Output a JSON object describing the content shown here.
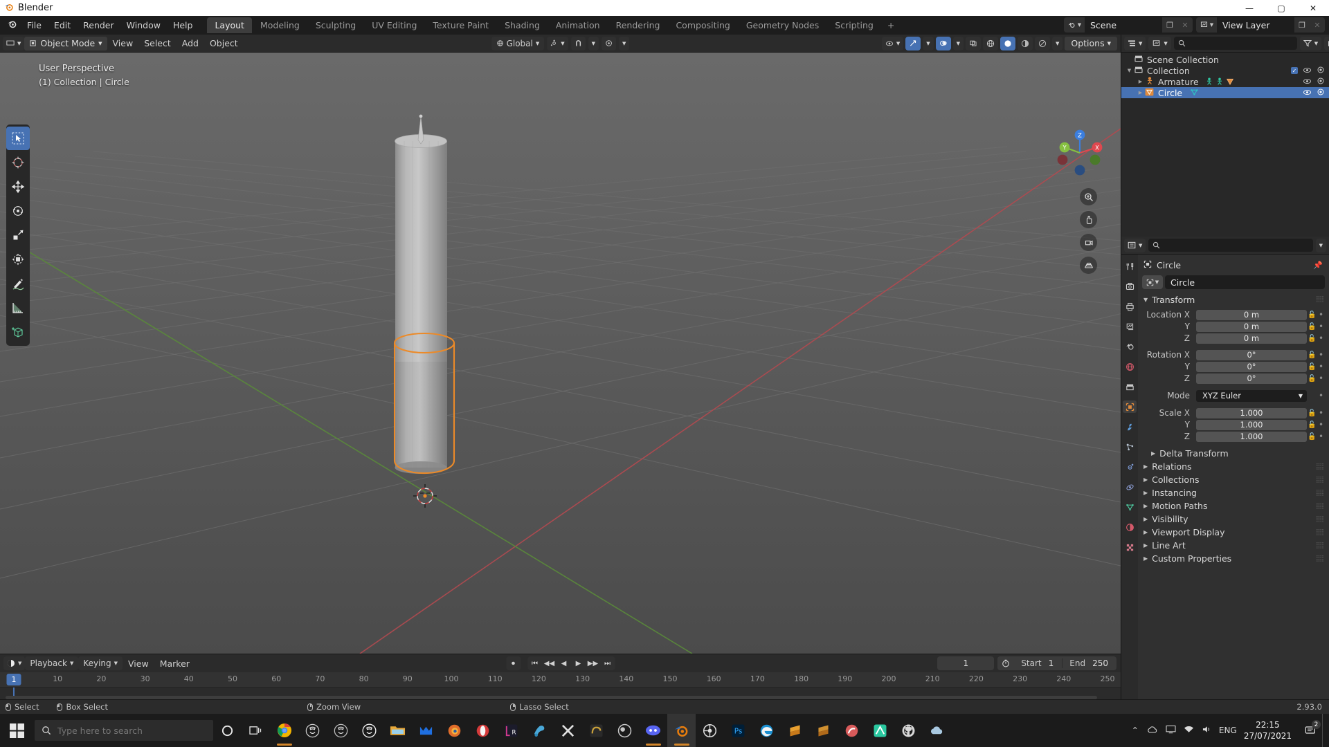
{
  "window": {
    "app_title": "Blender",
    "app_icon": "blender-logo-icon",
    "minimize": "—",
    "maximize": "▢",
    "close": "✕"
  },
  "topbar": {
    "menus": [
      "File",
      "Edit",
      "Render",
      "Window",
      "Help"
    ],
    "workspaces": [
      {
        "label": "Layout",
        "active": true
      },
      {
        "label": "Modeling",
        "active": false
      },
      {
        "label": "Sculpting",
        "active": false
      },
      {
        "label": "UV Editing",
        "active": false
      },
      {
        "label": "Texture Paint",
        "active": false
      },
      {
        "label": "Shading",
        "active": false
      },
      {
        "label": "Animation",
        "active": false
      },
      {
        "label": "Rendering",
        "active": false
      },
      {
        "label": "Compositing",
        "active": false
      },
      {
        "label": "Geometry Nodes",
        "active": false
      },
      {
        "label": "Scripting",
        "active": false
      },
      {
        "label": "+",
        "active": false
      }
    ],
    "scene_name": "Scene",
    "view_layer_name": "View Layer",
    "new_scene_icon": "duplicate-icon",
    "remove_scene_icon": "x-icon"
  },
  "viewport_header": {
    "mode": "Object Mode",
    "menus": [
      "View",
      "Select",
      "Add",
      "Object"
    ],
    "transform_orientation": "Global",
    "options_label": "Options",
    "snap_icon": "magnet-icon",
    "proportional_icon": "proportional-edit-icon",
    "visibility_icon": "eye-icon",
    "gizmo_icon": "gizmo-icon",
    "overlays_icon": "overlays-icon",
    "xray_icon": "xray-icon",
    "shading_modes": [
      "wireframe",
      "solid",
      "material-preview",
      "rendered"
    ],
    "shading_active": "solid"
  },
  "viewport": {
    "perspective_label": "User Perspective",
    "context_label": "(1) Collection | Circle",
    "tools": [
      {
        "name": "tweak-tool",
        "active": true
      },
      {
        "name": "cursor-tool",
        "active": false
      },
      {
        "name": "move-tool",
        "active": false
      },
      {
        "name": "rotate-tool",
        "active": false
      },
      {
        "name": "scale-tool",
        "active": false
      },
      {
        "name": "transform-tool",
        "active": false
      },
      {
        "name": "annotate-tool",
        "active": false
      },
      {
        "name": "measure-tool",
        "active": false
      },
      {
        "name": "add-cube-tool",
        "active": false
      }
    ],
    "gizmo_axes": [
      {
        "label": "X",
        "color": "#e0484f"
      },
      {
        "label": "Y",
        "color": "#86c041"
      },
      {
        "label": "Z",
        "color": "#3b7ede"
      }
    ],
    "nav_buttons": [
      "zoom-icon",
      "pan-icon",
      "camera-icon",
      "ortho-persp-icon"
    ]
  },
  "outliner": {
    "search_placeholder": "",
    "filter_icon": "filter-icon",
    "new_collection_icon": "new-collection-icon",
    "display_mode_icon": "view-layer-icon",
    "rows": [
      {
        "label": "Scene Collection",
        "icon": "collection-icon",
        "indent": 0,
        "selected": false,
        "has_disclosure": false,
        "checkbox": false,
        "eye": false,
        "camera": false
      },
      {
        "label": "Collection",
        "icon": "collection-icon",
        "indent": 1,
        "selected": false,
        "has_disclosure": true,
        "checkbox": true,
        "eye": true,
        "camera": true
      },
      {
        "label": "Armature",
        "icon": "armature-icon",
        "indent": 2,
        "selected": false,
        "has_disclosure": true,
        "checkbox": false,
        "eye": true,
        "camera": true
      },
      {
        "label": "Circle",
        "icon": "mesh-data-icon",
        "indent": 2,
        "selected": true,
        "has_disclosure": true,
        "checkbox": false,
        "eye": true,
        "camera": true
      }
    ]
  },
  "properties": {
    "search_placeholder": "",
    "breadcrumb_object": "Circle",
    "object_name": "Circle",
    "pin_icon": "pin-icon",
    "tabs": [
      {
        "name": "tool-tab",
        "glyph": "⚒",
        "color": "#c9c9c9",
        "active": false
      },
      {
        "name": "render-tab",
        "glyph": "☰",
        "color": "#c9c9c9",
        "active": false
      },
      {
        "name": "output-tab",
        "glyph": "⎙",
        "color": "#c9c9c9",
        "active": false
      },
      {
        "name": "view-layer-tab",
        "glyph": "▣",
        "color": "#c9c9c9",
        "active": false
      },
      {
        "name": "scene-tab",
        "glyph": "◔",
        "color": "#c9c9c9",
        "active": false
      },
      {
        "name": "world-tab",
        "glyph": "●",
        "color": "#d4596a",
        "active": false
      },
      {
        "name": "collection-tab",
        "glyph": "▤",
        "color": "#c9c9c9",
        "active": false
      },
      {
        "name": "object-tab",
        "glyph": "▣",
        "color": "#e08a3c",
        "active": true
      },
      {
        "name": "modifiers-tab",
        "glyph": "ὒ7",
        "color": "#5e9bd8",
        "active": false
      },
      {
        "name": "particles-tab",
        "glyph": "⁂",
        "color": "#b6c2d0",
        "active": false
      },
      {
        "name": "physics-tab",
        "glyph": "◎",
        "color": "#7c9ad4",
        "active": false
      },
      {
        "name": "constraints-tab",
        "glyph": "⛓",
        "color": "#8899cc",
        "active": false
      },
      {
        "name": "object-data-tab",
        "glyph": "▽",
        "color": "#4ec9a0",
        "active": false
      },
      {
        "name": "material-tab",
        "glyph": "◕",
        "color": "#d4596a",
        "active": false
      },
      {
        "name": "texture-tab",
        "glyph": "▦",
        "color": "#d4798a",
        "active": false
      }
    ],
    "transform_panel": "Transform",
    "location": {
      "label_x": "Location X",
      "label_y": "Y",
      "label_z": "Z",
      "x": "0 m",
      "y": "0 m",
      "z": "0 m"
    },
    "rotation": {
      "label_x": "Rotation X",
      "label_y": "Y",
      "label_z": "Z",
      "x": "0°",
      "y": "0°",
      "z": "0°"
    },
    "mode": {
      "label": "Mode",
      "value": "XYZ Euler"
    },
    "scale": {
      "label_x": "Scale X",
      "label_y": "Y",
      "label_z": "Z",
      "x": "1.000",
      "y": "1.000",
      "z": "1.000"
    },
    "sections": [
      "Delta Transform",
      "Relations",
      "Collections",
      "Instancing",
      "Motion Paths",
      "Visibility",
      "Viewport Display",
      "Line Art",
      "Custom Properties"
    ]
  },
  "timeline": {
    "editor_icon": "timeline-icon",
    "menus": [
      "Playback",
      "Keying",
      "View",
      "Marker"
    ],
    "record_icon": "record-icon",
    "transport": [
      "jump-start",
      "prev-keyframe",
      "play-reverse",
      "play",
      "next-keyframe",
      "jump-end"
    ],
    "current_frame": "1",
    "auto_key_icon": "stopwatch-icon",
    "start_label": "Start",
    "start_value": "1",
    "end_label": "End",
    "end_value": "250",
    "ticks": [
      "1",
      "10",
      "20",
      "30",
      "40",
      "50",
      "60",
      "70",
      "80",
      "90",
      "100",
      "110",
      "120",
      "130",
      "140",
      "150",
      "160",
      "170",
      "180",
      "190",
      "200",
      "210",
      "220",
      "230",
      "240",
      "250"
    ]
  },
  "statusbar": {
    "items": [
      {
        "label": "Select",
        "mouse": "l"
      },
      {
        "label": "Box Select",
        "mouse": "l"
      },
      {
        "label": "Zoom View",
        "mouse": "m"
      },
      {
        "label": "Lasso Select",
        "mouse": "r"
      }
    ],
    "version": "2.93.0"
  },
  "taskbar": {
    "start_icon": "windows-start-icon",
    "search_placeholder": "Type here to search",
    "cortana_icon": "cortana-icon",
    "taskview_icon": "task-view-icon",
    "apps": [
      {
        "name": "chrome-icon",
        "color": "#e8e8e8",
        "running": true,
        "active": false
      },
      {
        "name": "unreal-engine-icon",
        "color": "#cfcfcf",
        "running": false,
        "active": false
      },
      {
        "name": "unreal-engine-icon",
        "color": "#cfcfcf",
        "running": false,
        "active": false
      },
      {
        "name": "unreal-engine-icon",
        "color": "#e8e8e8",
        "running": false,
        "active": false
      },
      {
        "name": "file-explorer-icon",
        "color": "#e8b54a",
        "running": false,
        "active": false
      },
      {
        "name": "malwarebytes-icon",
        "color": "#1f6fe0",
        "running": false,
        "active": false
      },
      {
        "name": "firefox-icon",
        "color": "#e06c2a",
        "running": false,
        "active": false
      },
      {
        "name": "opera-icon",
        "color": "#d43a3a",
        "running": false,
        "active": false
      },
      {
        "name": "rider-icon",
        "color": "#d43a8a",
        "running": false,
        "active": false
      },
      {
        "name": "paint-icon",
        "color": "#4aa8d8",
        "running": false,
        "active": false
      },
      {
        "name": "xsplit-icon",
        "color": "#d8d8d8",
        "running": false,
        "active": false
      },
      {
        "name": "substance-icon",
        "color": "#c8a03a",
        "running": false,
        "active": false
      },
      {
        "name": "obs-icon",
        "color": "#c8c8c8",
        "running": false,
        "active": false
      },
      {
        "name": "discord-icon",
        "color": "#5865f2",
        "running": true,
        "active": false
      },
      {
        "name": "blender-icon",
        "color": "#e87d0d",
        "running": true,
        "active": true
      },
      {
        "name": "wheel-icon",
        "color": "#e0e0e0",
        "running": false,
        "active": false
      },
      {
        "name": "photoshop-icon",
        "color": "#2aa8e0",
        "running": false,
        "active": false
      },
      {
        "name": "edge-icon",
        "color": "#3aa8d8",
        "running": false,
        "active": false
      },
      {
        "name": "sublime-icon",
        "color": "#e8a030",
        "running": false,
        "active": false
      },
      {
        "name": "sublime-icon",
        "color": "#d09030",
        "running": false,
        "active": false
      },
      {
        "name": "krita-icon",
        "color": "#d85a5a",
        "running": false,
        "active": false
      },
      {
        "name": "mixer-icon",
        "color": "#2ac8a0",
        "running": false,
        "active": false
      },
      {
        "name": "github-icon",
        "color": "#d8d8d8",
        "running": false,
        "active": false
      },
      {
        "name": "cloud-icon",
        "color": "#a8c8e0",
        "running": false,
        "active": false
      }
    ],
    "tray_icons": [
      "chevron-up-icon",
      "onedrive-icon",
      "monitor-icon",
      "network-icon",
      "volume-icon"
    ],
    "language": "ENG",
    "time": "22:15",
    "date": "27/07/2021",
    "notification_icon": "notification-icon",
    "notification_count": "2"
  }
}
